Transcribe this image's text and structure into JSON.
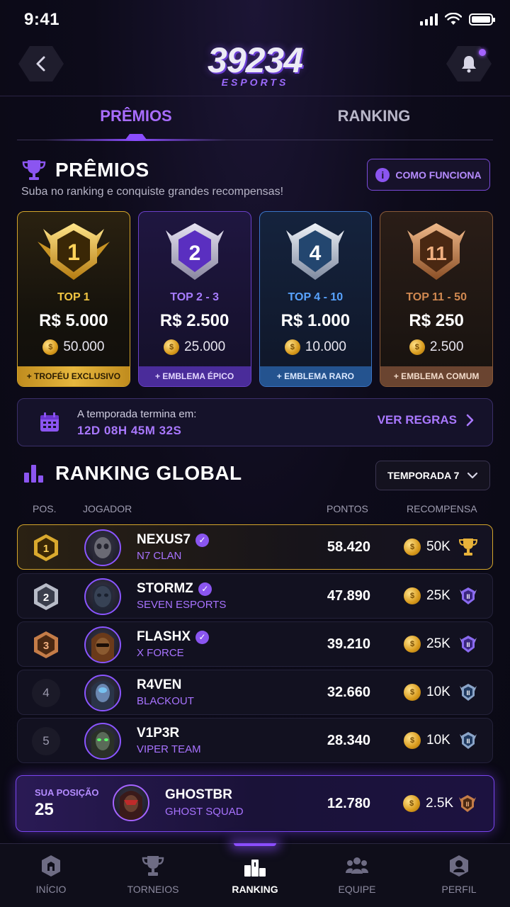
{
  "status_bar": {
    "time": "9:41"
  },
  "header": {
    "logo_number": "39234",
    "logo_sub": "ESPORTS"
  },
  "tabs": [
    {
      "label": "PRÊMIOS",
      "active": true
    },
    {
      "label": "RANKING",
      "active": false
    }
  ],
  "prizes": {
    "title": "PRÊMIOS",
    "subtitle": "Suba no ranking e conquiste grandes recompensas!",
    "how_button": "COMO FUNCIONA",
    "cards": [
      {
        "badge": "1",
        "tier": "TOP 1",
        "amount": "R$ 5.000",
        "coins": "50.000",
        "footer": "+ TROFÉU EXCLUSIVO",
        "color": "#d4a52a"
      },
      {
        "badge": "2",
        "tier": "TOP 2 - 3",
        "amount": "R$ 2.500",
        "coins": "25.000",
        "footer": "+ EMBLEMA ÉPICO",
        "color": "#6b40c9"
      },
      {
        "badge": "4",
        "tier": "TOP 4 - 10",
        "amount": "R$ 1.000",
        "coins": "10.000",
        "footer": "+ EMBLEMA RARO",
        "color": "#3a75c8"
      },
      {
        "badge": "11",
        "tier": "TOP 11 - 50",
        "amount": "R$ 250",
        "coins": "2.500",
        "footer": "+ EMBLEMA COMUM",
        "color": "#8a5a38"
      }
    ]
  },
  "season": {
    "label": "A temporada termina em:",
    "timer": "12D 08H 45M 32S",
    "rules_button": "VER REGRAS"
  },
  "ranking": {
    "title": "RANKING GLOBAL",
    "season_select": "TEMPORADA 7",
    "columns": {
      "pos": "POS.",
      "player": "JOGADOR",
      "points": "PONTOS",
      "reward": "RECOMPENSA"
    },
    "rows": [
      {
        "pos": "1",
        "name": "NEXUS7",
        "team": "N7 CLAN",
        "points": "58.420",
        "reward": "50K",
        "verified": true
      },
      {
        "pos": "2",
        "name": "STORMZ",
        "team": "SEVEN ESPORTS",
        "points": "47.890",
        "reward": "25K",
        "verified": true
      },
      {
        "pos": "3",
        "name": "FLASHX",
        "team": "X FORCE",
        "points": "39.210",
        "reward": "25K",
        "verified": true
      },
      {
        "pos": "4",
        "name": "R4VEN",
        "team": "BLACKOUT",
        "points": "32.660",
        "reward": "10K",
        "verified": false
      },
      {
        "pos": "5",
        "name": "V1P3R",
        "team": "VIPER TEAM",
        "points": "28.340",
        "reward": "10K",
        "verified": false
      }
    ]
  },
  "my_position": {
    "label": "SUA POSIÇÃO",
    "pos": "25",
    "name": "GHOSTBR",
    "team": "GHOST SQUAD",
    "points": "12.780",
    "reward": "2.5K"
  },
  "bottom_nav": [
    {
      "label": "INÍCIO",
      "icon": "home-icon",
      "active": false
    },
    {
      "label": "TORNEIOS",
      "icon": "trophy-icon",
      "active": false
    },
    {
      "label": "RANKING",
      "icon": "podium-icon",
      "active": true
    },
    {
      "label": "EQUIPE",
      "icon": "team-icon",
      "active": false
    },
    {
      "label": "PERFIL",
      "icon": "profile-icon",
      "active": false
    }
  ]
}
